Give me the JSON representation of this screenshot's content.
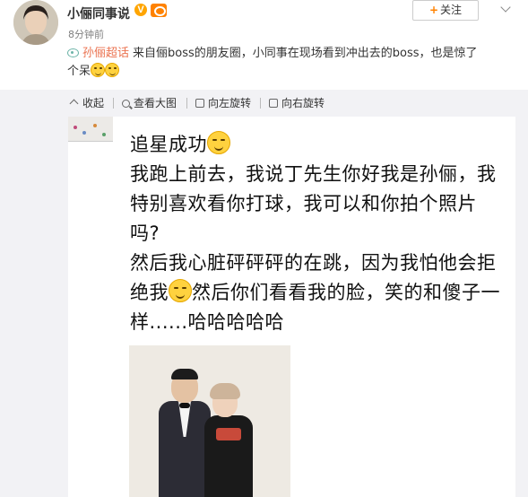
{
  "post": {
    "username": "小俪同事说",
    "verified_badge": "V",
    "timestamp": "8分钟前",
    "follow_label": "关注",
    "follow_plus": "+",
    "topic": "孙俪超话",
    "text_line1": "来自俪boss的朋友圈，小同事在现场看到冲出去的boss，也是惊了",
    "text_line2": "个呆"
  },
  "toolbar": {
    "collapse": "收起",
    "view_large": "查看大图",
    "rotate_left": "向左旋转",
    "rotate_right": "向右旋转"
  },
  "image_text": {
    "line1": "追星成功",
    "para1": "我跑上前去，我说丁先生你好我是孙俪，我特别喜欢看你打球，我可以和你拍个照片吗?",
    "para2a": "然后我心脏砰砰砰的在跳，因为我怕他会拒绝我",
    "para2b": "然后你们看看我的脸，笑的和傻子一样......哈哈哈哈哈"
  },
  "colors": {
    "topic_link": "#eb7350",
    "follow_plus": "#ff8200",
    "toolbar_bg": "#f2f2f5",
    "verified": "#ffa500"
  },
  "icons": [
    "topic-icon",
    "collapse-icon",
    "view-large-icon",
    "rotate-left-icon",
    "rotate-right-icon",
    "emoji-icon"
  ]
}
